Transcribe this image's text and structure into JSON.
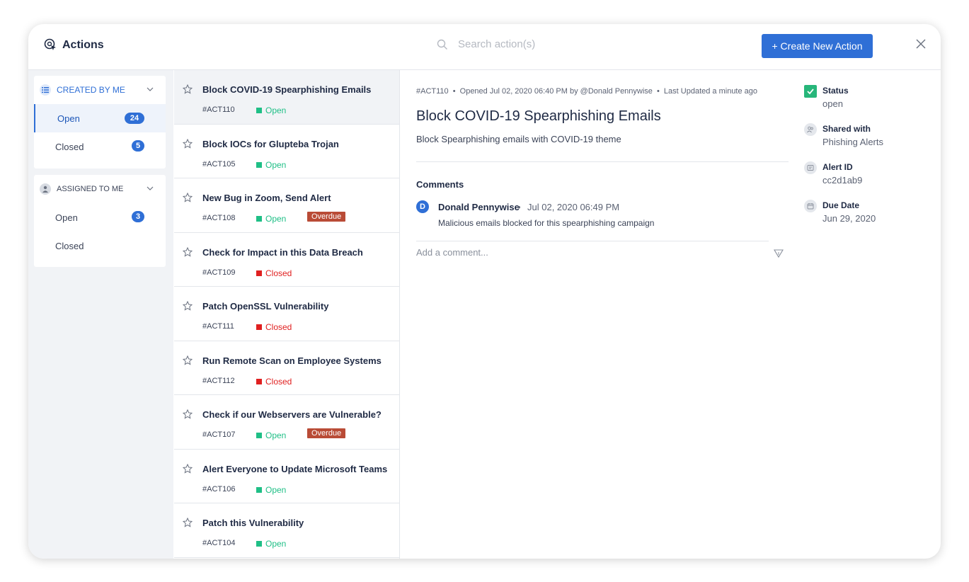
{
  "header": {
    "title": "Actions",
    "search_placeholder": "Search action(s)",
    "create_label": "+ Create New Action"
  },
  "colors": {
    "accent": "#2f6fd6",
    "open": "#1fbf86",
    "closed": "#e02020",
    "overdue": "#b94b36"
  },
  "sidebar": {
    "created_by_me": {
      "label": "CREATED BY ME",
      "items": [
        {
          "label": "Open",
          "count": "24"
        },
        {
          "label": "Closed",
          "count": "5"
        }
      ]
    },
    "assigned_to_me": {
      "label": "ASSIGNED TO ME",
      "items": [
        {
          "label": "Open",
          "count": "3"
        },
        {
          "label": "Closed"
        }
      ]
    }
  },
  "actions": [
    {
      "title": "Block COVID-19 Spearphishing Emails",
      "id": "#ACT110",
      "status": "Open"
    },
    {
      "title": "Block IOCs for Glupteba Trojan",
      "id": "#ACT105",
      "status": "Open"
    },
    {
      "title": "New Bug in Zoom, Send Alert",
      "id": "#ACT108",
      "status": "Open",
      "tag": "Overdue"
    },
    {
      "title": "Check for Impact in this Data Breach",
      "id": "#ACT109",
      "status": "Closed"
    },
    {
      "title": "Patch OpenSSL Vulnerability",
      "id": "#ACT111",
      "status": "Closed"
    },
    {
      "title": "Run Remote Scan on Employee Systems",
      "id": "#ACT112",
      "status": "Closed"
    },
    {
      "title": "Check if our Webservers are Vulnerable?",
      "id": "#ACT107",
      "status": "Open",
      "tag": "Overdue"
    },
    {
      "title": "Alert Everyone to Update Microsoft Teams",
      "id": "#ACT106",
      "status": "Open"
    },
    {
      "title": "Patch this Vulnerability",
      "id": "#ACT104",
      "status": "Open"
    }
  ],
  "detail": {
    "id": "#ACT110",
    "opened": "Opened Jul 02, 2020 06:40 PM by @Donald Pennywise",
    "updated": "Last Updated a minute ago",
    "title": "Block COVID-19 Spearphishing Emails",
    "description": "Block Spearphishing emails with COVID-19 theme",
    "comments_heading": "Comments",
    "comment": {
      "avatar": "D",
      "author": "Donald Pennywise",
      "date": "Jul 02, 2020 06:49 PM",
      "text": "Malicious emails blocked for this spearphishing campaign"
    },
    "add_comment_placeholder": "Add a comment..."
  },
  "properties": {
    "status": {
      "label": "Status",
      "value": "open"
    },
    "shared": {
      "label": "Shared with",
      "value": "Phishing Alerts"
    },
    "alert": {
      "label": "Alert ID",
      "value": "cc2d1ab9"
    },
    "due": {
      "label": "Due Date",
      "value": "Jun 29, 2020"
    }
  }
}
